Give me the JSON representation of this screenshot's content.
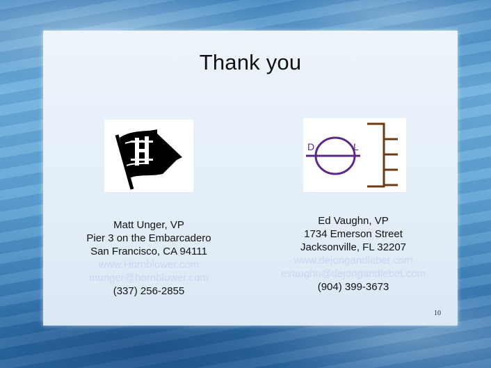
{
  "slide": {
    "title": "Thank you",
    "page_number": "10"
  },
  "left_contact": {
    "logo_icon": "flag-logo-icon",
    "name": "Matt Unger, VP",
    "address1": "Pier 3 on the Embarcadero",
    "address2": "San Francisco, CA 94111",
    "website": "www.Hornblower.com",
    "email": "munger@hornblower.com",
    "phone": "(337) 256-2855"
  },
  "right_contact": {
    "logo_icon": "dl-logo-icon",
    "logo_letter_left": "D",
    "logo_letter_right": "L",
    "name": "Ed Vaughn, VP",
    "address1": "1734 Emerson Street",
    "address2": "Jacksonville, FL 32207",
    "website": "www.dejongandlebet.com",
    "email": "evaughn@dejongandlebet.com",
    "phone": "(904) 399-3673"
  },
  "colors": {
    "link": "#cdd6f4",
    "dl_circle": "#5b2a86",
    "dl_bracket": "#6b3a12"
  }
}
